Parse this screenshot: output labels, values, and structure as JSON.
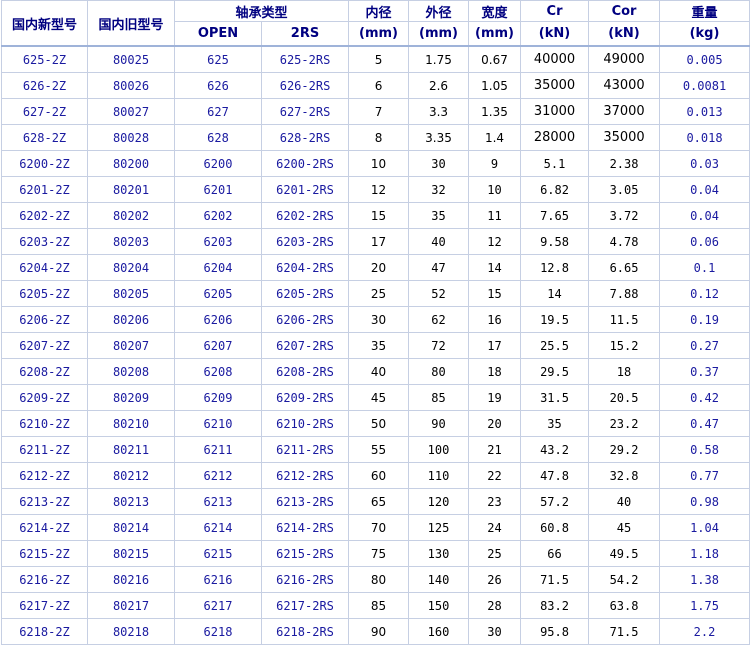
{
  "header": {
    "new_model": "国内新型号",
    "old_model": "国内旧型号",
    "bearing_type": "轴承类型",
    "open": "OPEN",
    "two_rs": "2RS",
    "inner_diameter": "内径",
    "inner_unit": "(mm)",
    "outer_diameter": "外径",
    "outer_unit": "(mm)",
    "width": "宽度",
    "width_unit": "(mm)",
    "cr": "Cr",
    "cr_unit": "(kN)",
    "cor": "Cor",
    "cor_unit": "(kN)",
    "weight": "重量",
    "weight_unit": "(kg)"
  },
  "rows": [
    {
      "new": "625-2Z",
      "old": "80025",
      "open": "625",
      "rs": "625-2RS",
      "d": "5",
      "D": "1.75",
      "B": "0.67",
      "cr": "40000",
      "cor": "49000",
      "wt": "0.005"
    },
    {
      "new": "626-2Z",
      "old": "80026",
      "open": "626",
      "rs": "626-2RS",
      "d": "6",
      "D": "2.6",
      "B": "1.05",
      "cr": "35000",
      "cor": "43000",
      "wt": "0.0081"
    },
    {
      "new": "627-2Z",
      "old": "80027",
      "open": "627",
      "rs": "627-2RS",
      "d": "7",
      "D": "3.3",
      "B": "1.35",
      "cr": "31000",
      "cor": "37000",
      "wt": "0.013"
    },
    {
      "new": "628-2Z",
      "old": "80028",
      "open": "628",
      "rs": "628-2RS",
      "d": "8",
      "D": "3.35",
      "B": "1.4",
      "cr": "28000",
      "cor": "35000",
      "wt": "0.018"
    },
    {
      "new": "6200-2Z",
      "old": "80200",
      "open": "6200",
      "rs": "6200-2RS",
      "d": "10",
      "D": "30",
      "B": "9",
      "cr": "5.1",
      "cor": "2.38",
      "wt": "0.03"
    },
    {
      "new": "6201-2Z",
      "old": "80201",
      "open": "6201",
      "rs": "6201-2RS",
      "d": "12",
      "D": "32",
      "B": "10",
      "cr": "6.82",
      "cor": "3.05",
      "wt": "0.04"
    },
    {
      "new": "6202-2Z",
      "old": "80202",
      "open": "6202",
      "rs": "6202-2RS",
      "d": "15",
      "D": "35",
      "B": "11",
      "cr": "7.65",
      "cor": "3.72",
      "wt": "0.04"
    },
    {
      "new": "6203-2Z",
      "old": "80203",
      "open": "6203",
      "rs": "6203-2RS",
      "d": "17",
      "D": "40",
      "B": "12",
      "cr": "9.58",
      "cor": "4.78",
      "wt": "0.06"
    },
    {
      "new": "6204-2Z",
      "old": "80204",
      "open": "6204",
      "rs": "6204-2RS",
      "d": "20",
      "D": "47",
      "B": "14",
      "cr": "12.8",
      "cor": "6.65",
      "wt": "0.1"
    },
    {
      "new": "6205-2Z",
      "old": "80205",
      "open": "6205",
      "rs": "6205-2RS",
      "d": "25",
      "D": "52",
      "B": "15",
      "cr": "14",
      "cor": "7.88",
      "wt": "0.12"
    },
    {
      "new": "6206-2Z",
      "old": "80206",
      "open": "6206",
      "rs": "6206-2RS",
      "d": "30",
      "D": "62",
      "B": "16",
      "cr": "19.5",
      "cor": "11.5",
      "wt": "0.19"
    },
    {
      "new": "6207-2Z",
      "old": "80207",
      "open": "6207",
      "rs": "6207-2RS",
      "d": "35",
      "D": "72",
      "B": "17",
      "cr": "25.5",
      "cor": "15.2",
      "wt": "0.27"
    },
    {
      "new": "6208-2Z",
      "old": "80208",
      "open": "6208",
      "rs": "6208-2RS",
      "d": "40",
      "D": "80",
      "B": "18",
      "cr": "29.5",
      "cor": "18",
      "wt": "0.37"
    },
    {
      "new": "6209-2Z",
      "old": "80209",
      "open": "6209",
      "rs": "6209-2RS",
      "d": "45",
      "D": "85",
      "B": "19",
      "cr": "31.5",
      "cor": "20.5",
      "wt": "0.42"
    },
    {
      "new": "6210-2Z",
      "old": "80210",
      "open": "6210",
      "rs": "6210-2RS",
      "d": "50",
      "D": "90",
      "B": "20",
      "cr": "35",
      "cor": "23.2",
      "wt": "0.47"
    },
    {
      "new": "6211-2Z",
      "old": "80211",
      "open": "6211",
      "rs": "6211-2RS",
      "d": "55",
      "D": "100",
      "B": "21",
      "cr": "43.2",
      "cor": "29.2",
      "wt": "0.58"
    },
    {
      "new": "6212-2Z",
      "old": "80212",
      "open": "6212",
      "rs": "6212-2RS",
      "d": "60",
      "D": "110",
      "B": "22",
      "cr": "47.8",
      "cor": "32.8",
      "wt": "0.77"
    },
    {
      "new": "6213-2Z",
      "old": "80213",
      "open": "6213",
      "rs": "6213-2RS",
      "d": "65",
      "D": "120",
      "B": "23",
      "cr": "57.2",
      "cor": "40",
      "wt": "0.98"
    },
    {
      "new": "6214-2Z",
      "old": "80214",
      "open": "6214",
      "rs": "6214-2RS",
      "d": "70",
      "D": "125",
      "B": "24",
      "cr": "60.8",
      "cor": "45",
      "wt": "1.04"
    },
    {
      "new": "6215-2Z",
      "old": "80215",
      "open": "6215",
      "rs": "6215-2RS",
      "d": "75",
      "D": "130",
      "B": "25",
      "cr": "66",
      "cor": "49.5",
      "wt": "1.18"
    },
    {
      "new": "6216-2Z",
      "old": "80216",
      "open": "6216",
      "rs": "6216-2RS",
      "d": "80",
      "D": "140",
      "B": "26",
      "cr": "71.5",
      "cor": "54.2",
      "wt": "1.38"
    },
    {
      "new": "6217-2Z",
      "old": "80217",
      "open": "6217",
      "rs": "6217-2RS",
      "d": "85",
      "D": "150",
      "B": "28",
      "cr": "83.2",
      "cor": "63.8",
      "wt": "1.75"
    },
    {
      "new": "6218-2Z",
      "old": "80218",
      "open": "6218",
      "rs": "6218-2RS",
      "d": "90",
      "D": "160",
      "B": "30",
      "cr": "95.8",
      "cor": "71.5",
      "wt": "2.2"
    }
  ]
}
